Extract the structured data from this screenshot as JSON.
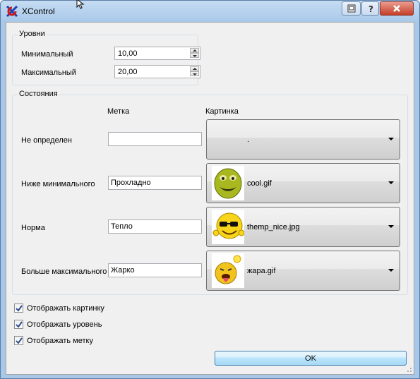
{
  "window": {
    "title": "XControl"
  },
  "levels": {
    "group_title": "Уровни",
    "min_label": "Минимальный",
    "min_value": "10,00",
    "max_label": "Максимальный",
    "max_value": "20,00"
  },
  "states": {
    "group_title": "Состояния",
    "col_label": "Метка",
    "col_picture": "Картинка",
    "rows": [
      {
        "name": "Не определен",
        "label": "",
        "picture": ".",
        "icon": "none"
      },
      {
        "name": "Ниже минимального",
        "label": "Прохладно",
        "picture": "cool.gif",
        "icon": "green-smiley-icon"
      },
      {
        "name": "Норма",
        "label": "Тепло",
        "picture": "themp_nice.jpg",
        "icon": "sunglasses-smiley-icon"
      },
      {
        "name": "Больше максимального",
        "label": "Жарко",
        "picture": "жара.gif",
        "icon": "hot-smiley-icon"
      }
    ]
  },
  "options": {
    "show_picture": "Отображать картинку",
    "show_level": "Отображать уровень",
    "show_label": "Отображать метку"
  },
  "ok_label": "OK"
}
